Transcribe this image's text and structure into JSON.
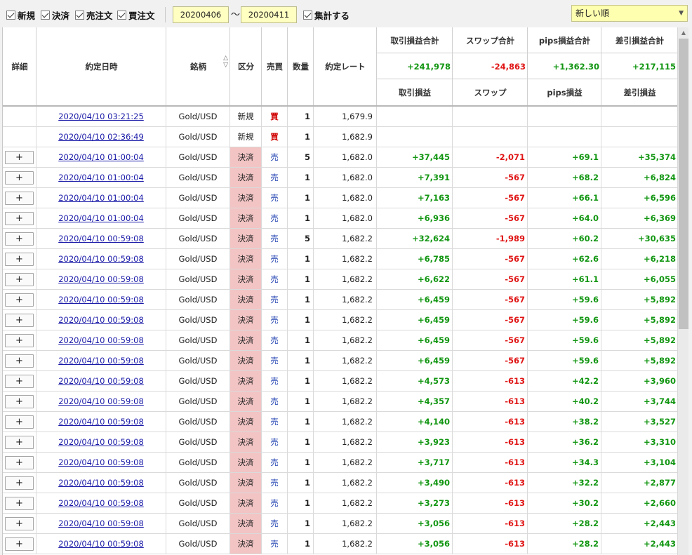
{
  "toolbar": {
    "filters": [
      {
        "label": "新規"
      },
      {
        "label": "決済"
      },
      {
        "label": "売注文"
      },
      {
        "label": "買注文"
      }
    ],
    "date_from": "20200406",
    "date_separator": "〜",
    "date_to": "20200411",
    "aggregate_label": "集計する",
    "sort_value": "新しい順"
  },
  "columns": {
    "detail": "詳細",
    "datetime": "約定日時",
    "symbol": "銘柄",
    "kind": "区分",
    "side": "売買",
    "qty": "数量",
    "rate": "約定レート",
    "pl": "取引損益",
    "swap": "スワップ",
    "pips": "pips損益",
    "net": "差引損益"
  },
  "totals": {
    "pl_label": "取引損益合計",
    "swap_label": "スワップ合計",
    "pips_label": "pips損益合計",
    "net_label": "差引損益合計",
    "pl": "+241,978",
    "swap": "-24,863",
    "pips": "+1,362.30",
    "net": "+217,115"
  },
  "colors": {
    "positive": "#129612",
    "negative": "#e01616",
    "close_bg": "#f2c4c4",
    "input_bg": "#ffffc2"
  },
  "plus_label": "+",
  "rows": [
    {
      "datetime": "2020/04/10 03:21:25",
      "symbol": "Gold/USD",
      "kind": "新規",
      "side": "買",
      "qty": "1",
      "rate": "1,679.9",
      "pl": "",
      "swap": "",
      "pips": "",
      "net": "",
      "has_detail": false
    },
    {
      "datetime": "2020/04/10 02:36:49",
      "symbol": "Gold/USD",
      "kind": "新規",
      "side": "買",
      "qty": "1",
      "rate": "1,682.9",
      "pl": "",
      "swap": "",
      "pips": "",
      "net": "",
      "has_detail": false
    },
    {
      "datetime": "2020/04/10 01:00:04",
      "symbol": "Gold/USD",
      "kind": "決済",
      "side": "売",
      "qty": "5",
      "rate": "1,682.0",
      "pl": "+37,445",
      "swap": "-2,071",
      "pips": "+69.1",
      "net": "+35,374",
      "has_detail": true
    },
    {
      "datetime": "2020/04/10 01:00:04",
      "symbol": "Gold/USD",
      "kind": "決済",
      "side": "売",
      "qty": "1",
      "rate": "1,682.0",
      "pl": "+7,391",
      "swap": "-567",
      "pips": "+68.2",
      "net": "+6,824",
      "has_detail": true
    },
    {
      "datetime": "2020/04/10 01:00:04",
      "symbol": "Gold/USD",
      "kind": "決済",
      "side": "売",
      "qty": "1",
      "rate": "1,682.0",
      "pl": "+7,163",
      "swap": "-567",
      "pips": "+66.1",
      "net": "+6,596",
      "has_detail": true
    },
    {
      "datetime": "2020/04/10 01:00:04",
      "symbol": "Gold/USD",
      "kind": "決済",
      "side": "売",
      "qty": "1",
      "rate": "1,682.0",
      "pl": "+6,936",
      "swap": "-567",
      "pips": "+64.0",
      "net": "+6,369",
      "has_detail": true
    },
    {
      "datetime": "2020/04/10 00:59:08",
      "symbol": "Gold/USD",
      "kind": "決済",
      "side": "売",
      "qty": "5",
      "rate": "1,682.2",
      "pl": "+32,624",
      "swap": "-1,989",
      "pips": "+60.2",
      "net": "+30,635",
      "has_detail": true
    },
    {
      "datetime": "2020/04/10 00:59:08",
      "symbol": "Gold/USD",
      "kind": "決済",
      "side": "売",
      "qty": "1",
      "rate": "1,682.2",
      "pl": "+6,785",
      "swap": "-567",
      "pips": "+62.6",
      "net": "+6,218",
      "has_detail": true
    },
    {
      "datetime": "2020/04/10 00:59:08",
      "symbol": "Gold/USD",
      "kind": "決済",
      "side": "売",
      "qty": "1",
      "rate": "1,682.2",
      "pl": "+6,622",
      "swap": "-567",
      "pips": "+61.1",
      "net": "+6,055",
      "has_detail": true
    },
    {
      "datetime": "2020/04/10 00:59:08",
      "symbol": "Gold/USD",
      "kind": "決済",
      "side": "売",
      "qty": "1",
      "rate": "1,682.2",
      "pl": "+6,459",
      "swap": "-567",
      "pips": "+59.6",
      "net": "+5,892",
      "has_detail": true
    },
    {
      "datetime": "2020/04/10 00:59:08",
      "symbol": "Gold/USD",
      "kind": "決済",
      "side": "売",
      "qty": "1",
      "rate": "1,682.2",
      "pl": "+6,459",
      "swap": "-567",
      "pips": "+59.6",
      "net": "+5,892",
      "has_detail": true
    },
    {
      "datetime": "2020/04/10 00:59:08",
      "symbol": "Gold/USD",
      "kind": "決済",
      "side": "売",
      "qty": "1",
      "rate": "1,682.2",
      "pl": "+6,459",
      "swap": "-567",
      "pips": "+59.6",
      "net": "+5,892",
      "has_detail": true
    },
    {
      "datetime": "2020/04/10 00:59:08",
      "symbol": "Gold/USD",
      "kind": "決済",
      "side": "売",
      "qty": "1",
      "rate": "1,682.2",
      "pl": "+6,459",
      "swap": "-567",
      "pips": "+59.6",
      "net": "+5,892",
      "has_detail": true
    },
    {
      "datetime": "2020/04/10 00:59:08",
      "symbol": "Gold/USD",
      "kind": "決済",
      "side": "売",
      "qty": "1",
      "rate": "1,682.2",
      "pl": "+4,573",
      "swap": "-613",
      "pips": "+42.2",
      "net": "+3,960",
      "has_detail": true
    },
    {
      "datetime": "2020/04/10 00:59:08",
      "symbol": "Gold/USD",
      "kind": "決済",
      "side": "売",
      "qty": "1",
      "rate": "1,682.2",
      "pl": "+4,357",
      "swap": "-613",
      "pips": "+40.2",
      "net": "+3,744",
      "has_detail": true
    },
    {
      "datetime": "2020/04/10 00:59:08",
      "symbol": "Gold/USD",
      "kind": "決済",
      "side": "売",
      "qty": "1",
      "rate": "1,682.2",
      "pl": "+4,140",
      "swap": "-613",
      "pips": "+38.2",
      "net": "+3,527",
      "has_detail": true
    },
    {
      "datetime": "2020/04/10 00:59:08",
      "symbol": "Gold/USD",
      "kind": "決済",
      "side": "売",
      "qty": "1",
      "rate": "1,682.2",
      "pl": "+3,923",
      "swap": "-613",
      "pips": "+36.2",
      "net": "+3,310",
      "has_detail": true
    },
    {
      "datetime": "2020/04/10 00:59:08",
      "symbol": "Gold/USD",
      "kind": "決済",
      "side": "売",
      "qty": "1",
      "rate": "1,682.2",
      "pl": "+3,717",
      "swap": "-613",
      "pips": "+34.3",
      "net": "+3,104",
      "has_detail": true
    },
    {
      "datetime": "2020/04/10 00:59:08",
      "symbol": "Gold/USD",
      "kind": "決済",
      "side": "売",
      "qty": "1",
      "rate": "1,682.2",
      "pl": "+3,490",
      "swap": "-613",
      "pips": "+32.2",
      "net": "+2,877",
      "has_detail": true
    },
    {
      "datetime": "2020/04/10 00:59:08",
      "symbol": "Gold/USD",
      "kind": "決済",
      "side": "売",
      "qty": "1",
      "rate": "1,682.2",
      "pl": "+3,273",
      "swap": "-613",
      "pips": "+30.2",
      "net": "+2,660",
      "has_detail": true
    },
    {
      "datetime": "2020/04/10 00:59:08",
      "symbol": "Gold/USD",
      "kind": "決済",
      "side": "売",
      "qty": "1",
      "rate": "1,682.2",
      "pl": "+3,056",
      "swap": "-613",
      "pips": "+28.2",
      "net": "+2,443",
      "has_detail": true
    },
    {
      "datetime": "2020/04/10 00:59:08",
      "symbol": "Gold/USD",
      "kind": "決済",
      "side": "売",
      "qty": "1",
      "rate": "1,682.2",
      "pl": "+3,056",
      "swap": "-613",
      "pips": "+28.2",
      "net": "+2,443",
      "has_detail": true
    }
  ]
}
